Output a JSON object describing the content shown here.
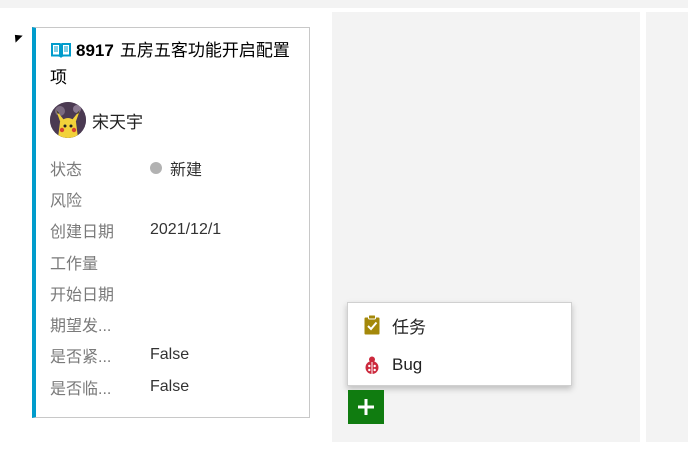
{
  "card": {
    "id": "8917",
    "title": "五房五客功能开启配置项",
    "owner": "宋天宇",
    "fields": [
      {
        "label": "状态",
        "value": "新建",
        "indicator": "state-dot"
      },
      {
        "label": "风险",
        "value": ""
      },
      {
        "label": "创建日期",
        "value": "2021/12/1"
      },
      {
        "label": "工作量",
        "value": ""
      },
      {
        "label": "开始日期",
        "value": ""
      },
      {
        "label": "期望发...",
        "value": ""
      },
      {
        "label": "是否紧...",
        "value": "False"
      },
      {
        "label": "是否临...",
        "value": "False"
      }
    ]
  },
  "add_menu": {
    "items": [
      {
        "label": "任务",
        "icon": "task-clipboard-icon"
      },
      {
        "label": "Bug",
        "icon": "bug-icon"
      }
    ]
  },
  "colors": {
    "card_accent": "#009ccc",
    "add_button": "#107c10",
    "task_icon": "#a4880a",
    "bug_icon": "#cc293d",
    "state_new": "#b2b2b2"
  }
}
